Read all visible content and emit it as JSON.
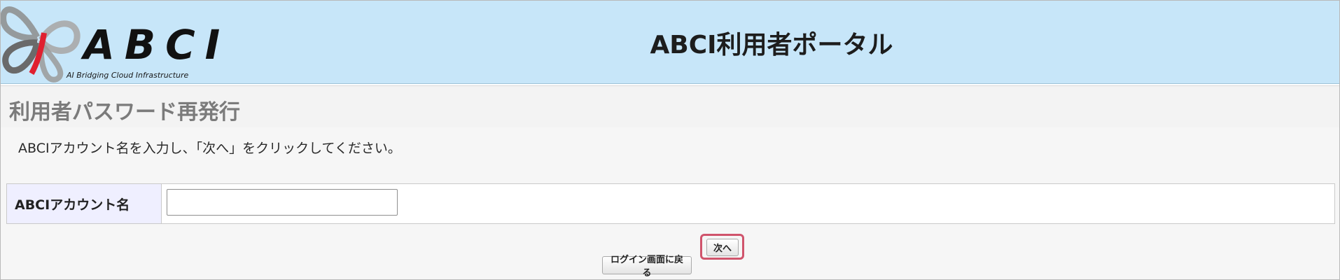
{
  "header": {
    "logo_text": "ABCI",
    "logo_subtitle": "AI Bridging Cloud Infrastructure",
    "portal_title": "ABCI利用者ポータル"
  },
  "page": {
    "title": "利用者パスワード再発行",
    "instruction": "ABCIアカウント名を入力し、「次へ」をクリックしてください。"
  },
  "form": {
    "account_label": "ABCIアカウント名",
    "account_value": "",
    "account_placeholder": ""
  },
  "buttons": {
    "back_label": "ログイン画面に戻る",
    "next_label": "次へ"
  },
  "colors": {
    "header_bg": "#c7e6f9",
    "logo_accent": "#e02030",
    "highlight_ring": "#d0546c",
    "label_bg": "#efefff"
  }
}
